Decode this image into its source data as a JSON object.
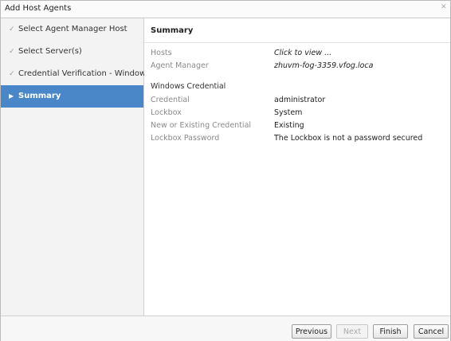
{
  "window": {
    "title": "Add Host Agents",
    "close_icon": "x-icon"
  },
  "sidebar": {
    "items": [
      {
        "label": "Select Agent Manager Host",
        "icon": "check-icon"
      },
      {
        "label": "Select Server(s)",
        "icon": "check-icon"
      },
      {
        "label": "Credential Verification - Windows",
        "icon": "check-icon"
      },
      {
        "label": "Summary",
        "icon": "arrow-right-icon",
        "active": true
      }
    ]
  },
  "main": {
    "title": "Summary",
    "rows": [
      {
        "key": "Hosts",
        "value": "Click to view ..."
      },
      {
        "key": "Agent Manager",
        "value": "zhuvm-fog-3359.vfog.loca"
      }
    ],
    "section_title": "Windows Credential",
    "credential_rows": [
      {
        "key": "Credential",
        "value": "administrator"
      },
      {
        "key": "Lockbox",
        "value": "System"
      },
      {
        "key": "New or Existing Credential",
        "value": "Existing"
      },
      {
        "key": "Lockbox Password",
        "value": "The Lockbox is not a password secured"
      }
    ]
  },
  "footer": {
    "previous_label": "Previous",
    "next_label": "Next",
    "finish_label": "Finish",
    "cancel_label": "Cancel"
  },
  "colors": {
    "active_step_bg": "#4a87c9",
    "sidebar_bg": "#f3f3f3"
  }
}
